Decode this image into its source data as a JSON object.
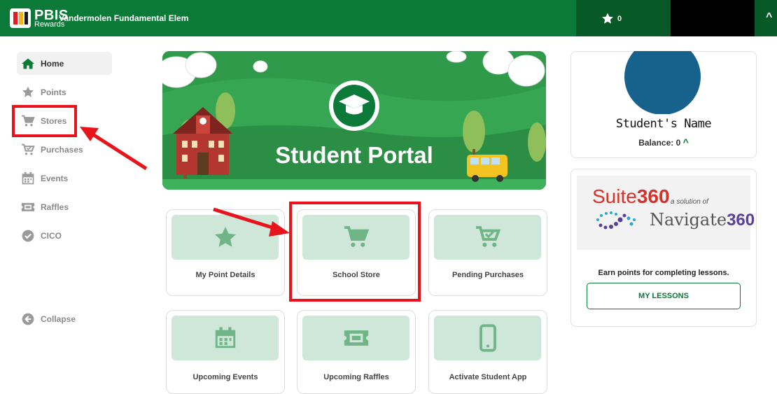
{
  "header": {
    "logo_big": "PBIS",
    "logo_small": "Rewards",
    "school_name": "Vandermolen Fundamental Elem",
    "star_count": "0",
    "caret": "^"
  },
  "sidebar": {
    "items": [
      {
        "label": "Home",
        "icon": "home-icon"
      },
      {
        "label": "Points",
        "icon": "star-icon"
      },
      {
        "label": "Stores",
        "icon": "cart-icon"
      },
      {
        "label": "Purchases",
        "icon": "cart-check-icon"
      },
      {
        "label": "Events",
        "icon": "calendar-icon"
      },
      {
        "label": "Raffles",
        "icon": "ticket-icon"
      },
      {
        "label": "CICO",
        "icon": "check-circle-icon"
      }
    ],
    "collapse_label": "Collapse"
  },
  "banner": {
    "title": "Student Portal"
  },
  "tiles": [
    {
      "label": "My Point Details",
      "icon": "star-icon"
    },
    {
      "label": "School Store",
      "icon": "cart-icon"
    },
    {
      "label": "Pending Purchases",
      "icon": "cart-check-icon"
    },
    {
      "label": "Upcoming Events",
      "icon": "calendar-icon"
    },
    {
      "label": "Upcoming Raffles",
      "icon": "ticket-icon"
    },
    {
      "label": "Activate Student App",
      "icon": "phone-icon"
    }
  ],
  "profile": {
    "student_name": "Student's Name",
    "balance": "Balance: 0",
    "balance_caret": "^"
  },
  "suite360": {
    "brand": "Suite",
    "brand_num": "360",
    "tagline": "a solution of",
    "navigate_word": "Navigate",
    "navigate_num": "360",
    "earn_text": "Earn points for completing lessons.",
    "button_label": "MY LESSONS"
  },
  "colors": {
    "header_green": "#0b7a38",
    "tile_bg": "#cfe7d8",
    "tile_icon": "#6fb587",
    "annotation_red": "#e8131b",
    "avatar": "#16628c"
  }
}
